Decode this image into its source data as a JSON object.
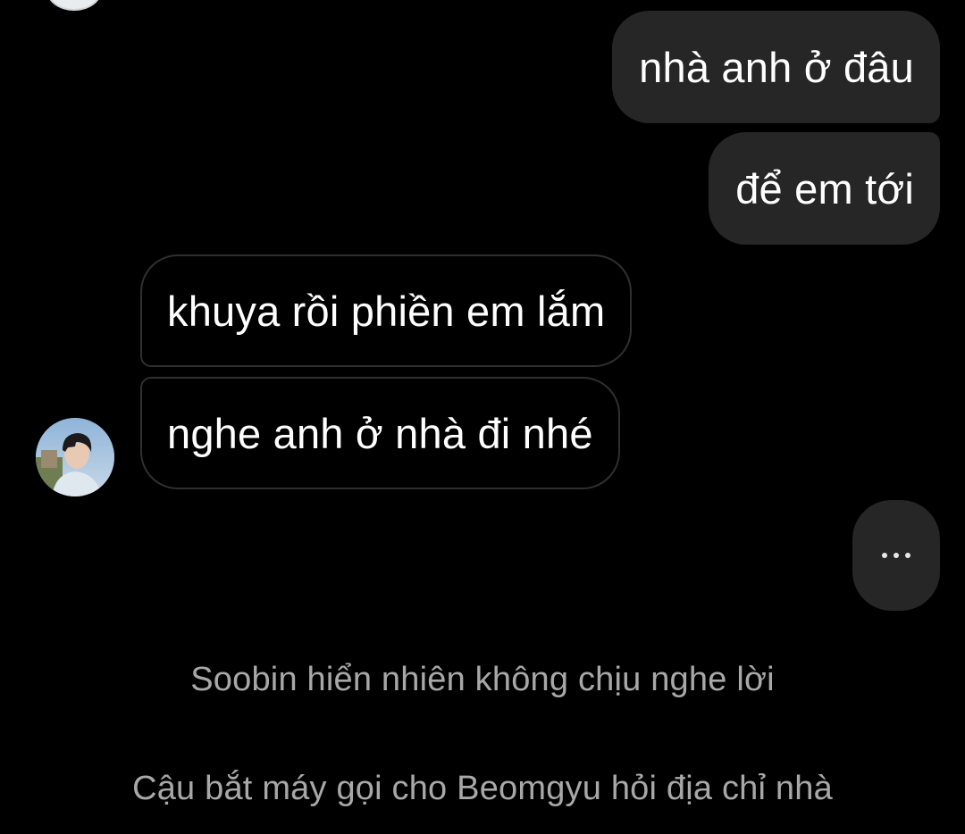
{
  "messages": [
    {
      "direction": "sent",
      "text": "nhà anh ở đâu"
    },
    {
      "direction": "sent",
      "text": "để em tới"
    },
    {
      "direction": "received",
      "text": "khuya rồi phiền em lắm"
    },
    {
      "direction": "received",
      "text": "nghe anh ở nhà đi nhé"
    }
  ],
  "typing_indicator": {
    "text": "..."
  },
  "narration": [
    "Soobin hiển nhiên không chịu nghe lời",
    "Cậu bắt máy gọi cho Beomgyu hỏi địa chỉ nhà"
  ],
  "colors": {
    "background": "#000000",
    "sent_bubble": "#262626",
    "received_border": "#2f2f2f",
    "narration_text": "#a8a8a8"
  },
  "icons": {
    "avatar": "contact-avatar-photo"
  }
}
